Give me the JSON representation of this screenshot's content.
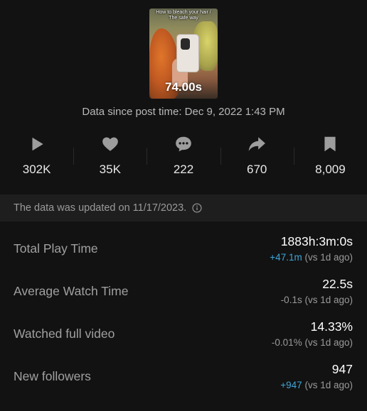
{
  "video": {
    "caption": "How to bleach your hair / The safe way",
    "duration": "74.00s"
  },
  "post_time": "Data since post time: Dec 9, 2022 1:43 PM",
  "stats": [
    {
      "icon": "play-icon",
      "value": "302K"
    },
    {
      "icon": "heart-icon",
      "value": "35K"
    },
    {
      "icon": "comment-icon",
      "value": "222"
    },
    {
      "icon": "share-icon",
      "value": "670"
    },
    {
      "icon": "bookmark-icon",
      "value": "8,009"
    }
  ],
  "notice": {
    "text": "The data was updated on 11/17/2023.",
    "icon": "info-icon"
  },
  "metrics": [
    {
      "label": "Total Play Time",
      "value": "1883h:3m:0s",
      "delta": "+47.1m",
      "suffix": " (vs 1d ago)"
    },
    {
      "label": "Average Watch Time",
      "value": "22.5s",
      "delta": "-0.1s",
      "suffix": " (vs 1d ago)"
    },
    {
      "label": "Watched full video",
      "value": "14.33%",
      "delta": "-0.01%",
      "suffix": " (vs 1d ago)"
    },
    {
      "label": "New followers",
      "value": "947",
      "delta": "+947",
      "suffix": " (vs 1d ago)"
    }
  ],
  "colors": {
    "background": "#121212",
    "notice_bg": "#1e1e1e",
    "positive": "#3ea5d8",
    "muted": "#9a9a9a"
  }
}
